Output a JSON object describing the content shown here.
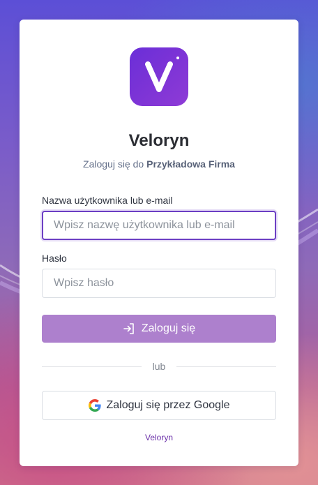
{
  "brand": {
    "name": "Veloryn",
    "logo_letter": "V",
    "logo_color": "#7433d6"
  },
  "subtitle": {
    "prefix": "Zaloguj się do",
    "organization": "Przykładowa Firma"
  },
  "form": {
    "username": {
      "label": "Nazwa użytkownika lub e-mail",
      "placeholder": "Wpisz nazwę użytkownika lub e-mail",
      "value": ""
    },
    "password": {
      "label": "Hasło",
      "placeholder": "Wpisz hasło",
      "value": ""
    },
    "login_button": {
      "label": "Zaloguj się",
      "icon": "sign-in-icon",
      "color": "#ad80cd"
    }
  },
  "divider": {
    "text": "lub"
  },
  "google_button": {
    "label": "Zaloguj się przez Google",
    "icon": "google-icon"
  },
  "footer": {
    "link_text": "Veloryn",
    "link_color": "#6a2fa8"
  },
  "colors": {
    "focus_border": "#6c3fc4",
    "heading": "#2b2d33"
  }
}
